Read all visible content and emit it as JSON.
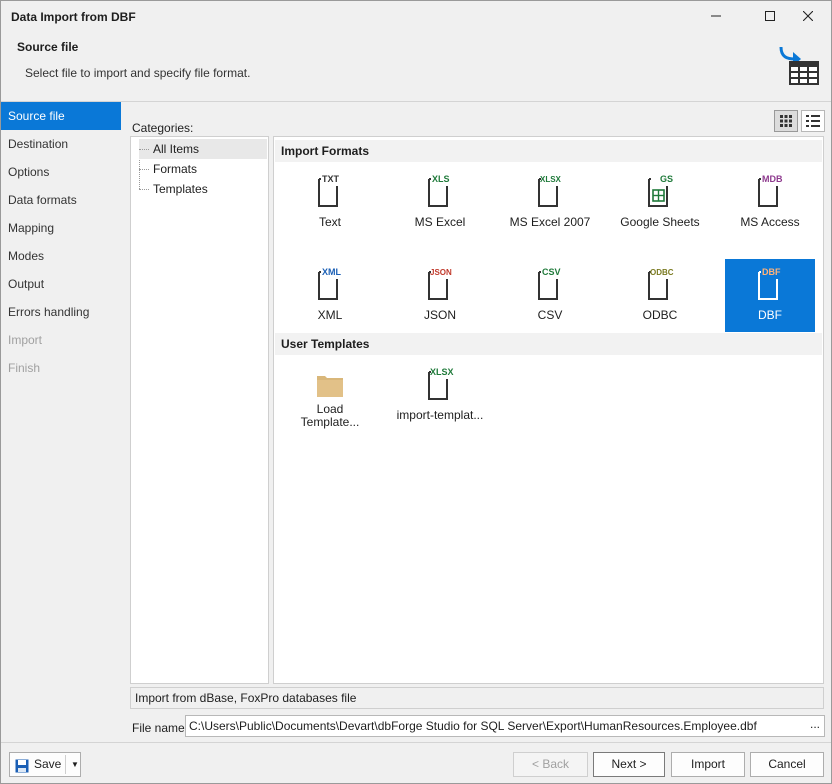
{
  "window": {
    "title": "Data Import from DBF"
  },
  "header": {
    "title": "Source file",
    "subtitle": "Select file to import and specify file format.",
    "icon": "import-table-icon"
  },
  "nav": {
    "items": [
      {
        "label": "Source file",
        "state": "active"
      },
      {
        "label": "Destination",
        "state": "normal"
      },
      {
        "label": "Options",
        "state": "normal"
      },
      {
        "label": "Data formats",
        "state": "normal"
      },
      {
        "label": "Mapping",
        "state": "normal"
      },
      {
        "label": "Modes",
        "state": "normal"
      },
      {
        "label": "Output",
        "state": "normal"
      },
      {
        "label": "Errors handling",
        "state": "normal"
      },
      {
        "label": "Import",
        "state": "disabled"
      },
      {
        "label": "Finish",
        "state": "disabled"
      }
    ]
  },
  "categories": {
    "label": "Categories:",
    "items": [
      "All Items",
      "Formats",
      "Templates"
    ],
    "selected": "All Items"
  },
  "gallery": {
    "import_formats_header": "Import Formats",
    "formats": [
      {
        "caption": "Text",
        "badge": "TXT",
        "color": "#333333"
      },
      {
        "caption": "MS Excel",
        "badge": "XLS",
        "color": "#1f7a3a"
      },
      {
        "caption": "MS Excel 2007",
        "badge": "XLSX",
        "color": "#1f7a3a"
      },
      {
        "caption": "Google Sheets",
        "badge": "GS",
        "color": "#1f7a3a"
      },
      {
        "caption": "MS Access",
        "badge": "MDB",
        "color": "#8e3a8e"
      },
      {
        "caption": "XML",
        "badge": "XML",
        "color": "#1b5fb5"
      },
      {
        "caption": "JSON",
        "badge": "JSON",
        "color": "#c0392b"
      },
      {
        "caption": "CSV",
        "badge": "CSV",
        "color": "#1f7a3a"
      },
      {
        "caption": "ODBC",
        "badge": "ODBC",
        "color": "#7a7a20"
      },
      {
        "caption": "DBF",
        "badge": "DBF",
        "color": "#e8722c"
      }
    ],
    "selected_format": "DBF",
    "user_templates_header": "User Templates",
    "templates": [
      {
        "caption_line1": "Load",
        "caption_line2": "Template...",
        "icon": "folder-icon"
      },
      {
        "caption": "import-templat...",
        "badge": "XLSX",
        "color": "#1f7a3a"
      }
    ]
  },
  "description": "Import from dBase, FoxPro databases file",
  "file": {
    "label": "File name:",
    "value": "C:\\Users\\Public\\Documents\\Devart\\dbForge Studio for SQL Server\\Export\\HumanResources.Employee.dbf",
    "browse": "..."
  },
  "footer": {
    "save": "Save",
    "back": "< Back",
    "next": "Next >",
    "import": "Import",
    "cancel": "Cancel"
  },
  "colors": {
    "accent": "#0a78d7",
    "disabled": "#a0a0a0"
  }
}
